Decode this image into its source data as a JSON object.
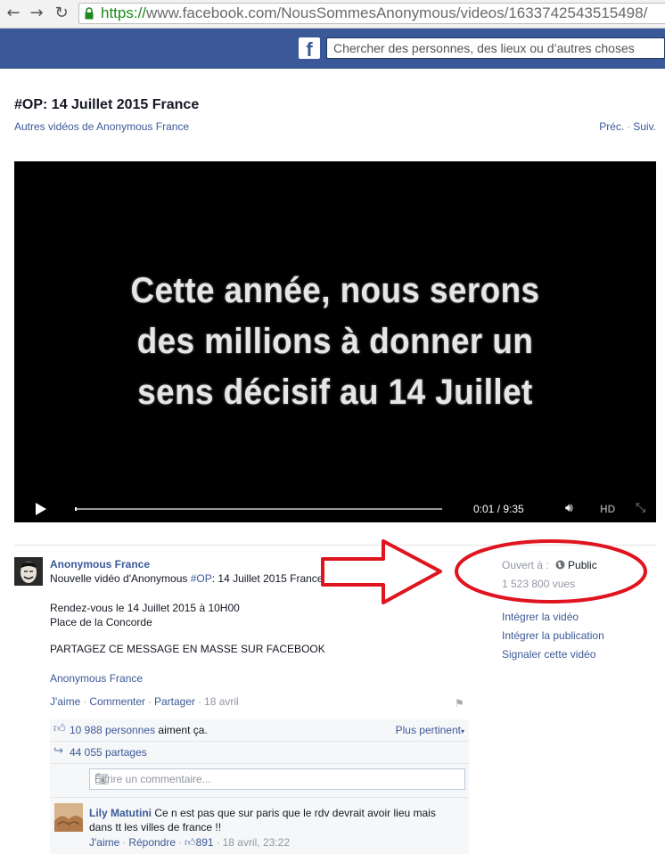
{
  "browser": {
    "url_scheme": "https://",
    "url_rest": "www.facebook.com/NousSommesAnonymous/videos/1633742543515498/",
    "back_icon": "back-arrow-icon",
    "forward_icon": "forward-arrow-icon",
    "reload_icon": "reload-icon"
  },
  "facebook": {
    "logo": "f",
    "search_placeholder": "Chercher des personnes, des lieux ou d’autres choses",
    "brand_color": "#3b5998"
  },
  "page": {
    "title": "#OP: 14 Juillet 2015 France",
    "more_videos": "Autres vidéos de Anonymous France",
    "prev": "Préc.",
    "next": "Suiv."
  },
  "video": {
    "caption_line1": "Cette année, nous serons",
    "caption_line2": "des millions à donner un",
    "caption_line3": "sens décisif au 14 Juillet",
    "time": "0:01 / 9:35",
    "hd_label": "HD",
    "progress": 0.0018
  },
  "post": {
    "author": "Anonymous France",
    "desc_prefix": "Nouvelle vidéo d'Anonymous ",
    "desc_tag": "#OP",
    "desc_suffix": ": 14 Juillet 2015 France",
    "line1": "Rendez-vous le 14 Juillet 2015 à 10H00",
    "line2": "Place de la Concorde",
    "line3": "PARTAGEZ CE MESSAGE EN MASSE SUR FACEBOOK",
    "signature": "Anonymous France",
    "actions": {
      "like": "J'aime",
      "comment": "Commenter",
      "share": "Partager",
      "date": "18 avril"
    },
    "likes_link": "10 988 personnes",
    "likes_suffix": " aiment ça.",
    "sort_label": "Plus pertinent",
    "shares": "44 055 partages",
    "comment_placeholder": "Écrire un commentaire..."
  },
  "comment": {
    "name": "Lily Matutini",
    "text": "Ce n est pas que sur paris que le rdv devrait avoir lieu mais dans tt les villes de france !!",
    "like": "J'aime",
    "reply": "Répondre",
    "like_count": "891",
    "date": "18 avril, 23:22"
  },
  "meta": {
    "open_label": "Ouvert à :",
    "public_label": "Public",
    "views": "1 523 800 vues",
    "embed_video": "Intégrer la vidéo",
    "embed_post": "Intégrer la publication",
    "report": "Signaler cette vidéo"
  },
  "annotation": {
    "color": "#e0141e"
  }
}
